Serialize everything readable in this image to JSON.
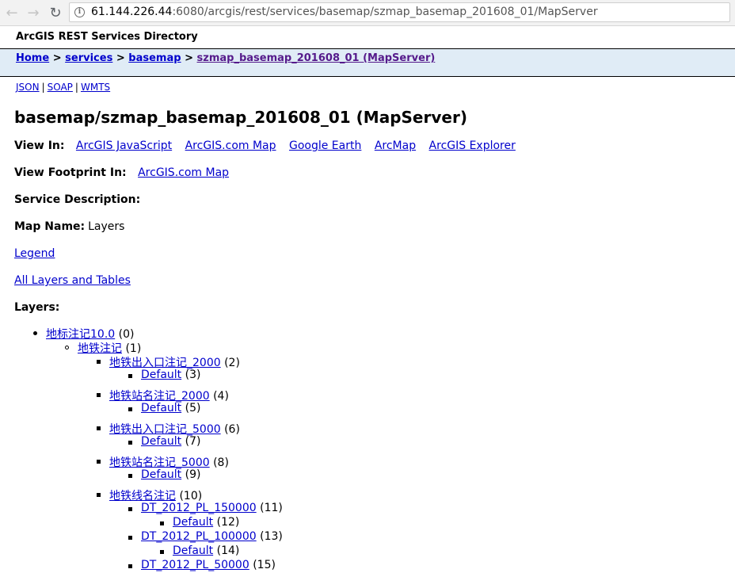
{
  "browser": {
    "url_host": "61.144.226.44",
    "url_rest": ":6080/arcgis/rest/services/basemap/szmap_basemap_201608_01/MapServer"
  },
  "header": {
    "directory_title": "ArcGIS REST Services Directory",
    "breadcrumb": {
      "home": "Home",
      "services": "services",
      "basemap": "basemap",
      "current": "szmap_basemap_201608_01 (MapServer)",
      "separator": ">"
    },
    "formats": [
      "JSON",
      "SOAP",
      "WMTS"
    ],
    "format_separator": "|"
  },
  "main": {
    "title": "basemap/szmap_basemap_201608_01 (MapServer)",
    "view_in_label": "View In:",
    "view_in_links": [
      "ArcGIS JavaScript",
      "ArcGIS.com Map",
      "Google Earth",
      "ArcMap",
      "ArcGIS Explorer"
    ],
    "view_footprint_label": "View Footprint In:",
    "view_footprint_link": "ArcGIS.com Map",
    "service_description_label": "Service Description:",
    "map_name_label": "Map Name:",
    "map_name_value": "Layers",
    "legend_link": "Legend",
    "all_layers_link": "All Layers and Tables",
    "layers_label": "Layers:"
  },
  "layers": [
    {
      "name": "地标注记10.0",
      "id": "(0)",
      "level": 0
    },
    {
      "name": "地铁注记",
      "id": "(1)",
      "level": 1
    },
    {
      "name": "地铁出入口注记_2000",
      "id": "(2)",
      "level": 2
    },
    {
      "name": "Default",
      "id": "(3)",
      "level": 3
    },
    {
      "name": "地铁站名注记_2000",
      "id": "(4)",
      "level": 2
    },
    {
      "name": "Default",
      "id": "(5)",
      "level": 3
    },
    {
      "name": "地铁出入口注记_5000",
      "id": "(6)",
      "level": 2
    },
    {
      "name": "Default",
      "id": "(7)",
      "level": 3
    },
    {
      "name": "地铁站名注记_5000",
      "id": "(8)",
      "level": 2
    },
    {
      "name": "Default",
      "id": "(9)",
      "level": 3
    },
    {
      "name": "地铁线名注记",
      "id": "(10)",
      "level": 2
    },
    {
      "name": "DT_2012_PL_150000",
      "id": "(11)",
      "level": 3
    },
    {
      "name": "Default",
      "id": "(12)",
      "level": 4
    },
    {
      "name": "DT_2012_PL_100000",
      "id": "(13)",
      "level": 3
    },
    {
      "name": "Default",
      "id": "(14)",
      "level": 4
    },
    {
      "name": "DT_2012_PL_50000",
      "id": "(15)",
      "level": 3
    }
  ]
}
